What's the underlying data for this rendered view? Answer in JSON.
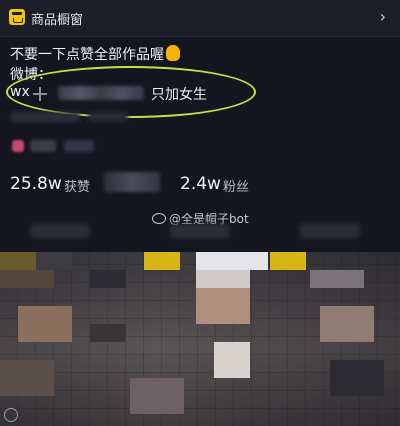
{
  "shop_bar": {
    "title": "商品橱窗",
    "chevron": "›"
  },
  "bio": {
    "line1": "不要一下点赞全部作品喔",
    "line2": "微博：",
    "wx_label": "wx",
    "wx_note": "只加女生"
  },
  "stats": {
    "likes_value": "25.8w",
    "likes_label": "获赞",
    "fans_value": "2.4w",
    "fans_label": "粉丝"
  },
  "watermark": {
    "text": "@全是帽子bot"
  },
  "colors": {
    "background": "#14161f",
    "highlight": "#c7e04a",
    "shop_icon": "#f1c40f"
  },
  "icons": {
    "shop": "shop-icon",
    "hand": "raised-hand-icon",
    "plus": "plus-icon",
    "chevron": "chevron-right-icon",
    "weibo": "weibo-icon"
  }
}
